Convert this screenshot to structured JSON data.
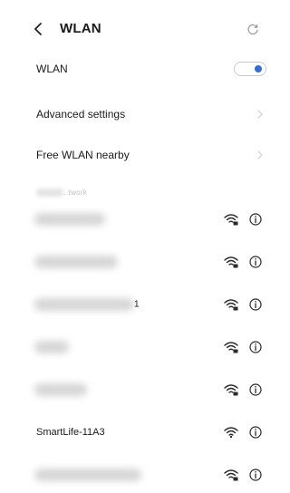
{
  "header": {
    "title": "WLAN",
    "back_icon": "chevron-left-icon",
    "refresh_icon": "refresh-icon"
  },
  "settings": {
    "wlan_label": "WLAN",
    "wlan_enabled": true,
    "advanced_label": "Advanced settings",
    "free_wlan_label": "Free WLAN nearby"
  },
  "networks_section": {
    "label": "...twork"
  },
  "networks": [
    {
      "name": "",
      "obscured": true,
      "signal": "wifi-locked-icon"
    },
    {
      "name": "",
      "obscured": true,
      "signal": "wifi-locked-icon"
    },
    {
      "name": "",
      "obscured": true,
      "trailing_char": "1",
      "signal": "wifi-locked-icon"
    },
    {
      "name": "",
      "obscured": true,
      "signal": "wifi-locked-icon"
    },
    {
      "name": "",
      "obscured": true,
      "signal": "wifi-locked-icon"
    },
    {
      "name": "SmartLife-11A3",
      "obscured": false,
      "signal": "wifi-icon"
    },
    {
      "name": "",
      "obscured": true,
      "signal": "wifi-locked-icon"
    }
  ],
  "colors": {
    "accent": "#2f6fd6",
    "text": "#1a1a1a",
    "muted": "#c2c2c2"
  }
}
